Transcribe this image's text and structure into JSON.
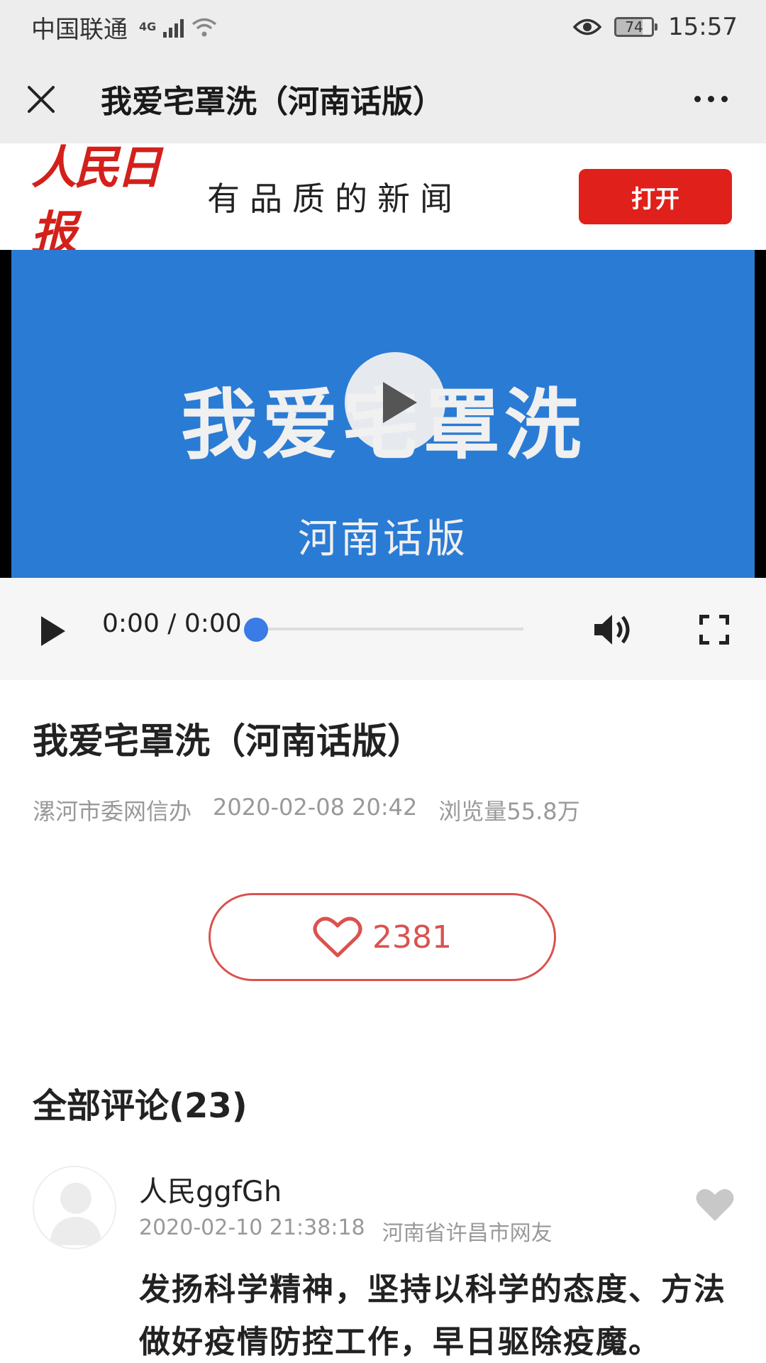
{
  "status_bar": {
    "carrier": "中国联通",
    "network": "4G",
    "battery": "74",
    "time": "15:57"
  },
  "title_bar": {
    "title": "我爱宅罩洗（河南话版）"
  },
  "banner": {
    "logo": "人民日报",
    "slogan": "有品质的新闻",
    "open_label": "打开",
    "brand_color": "#e0201a"
  },
  "video": {
    "title": "我爱宅罩洗",
    "subtitle": "河南话版",
    "background": "#2a7bd4"
  },
  "controls": {
    "time": "0:00 / 0:00",
    "progress": 0
  },
  "article": {
    "title": "我爱宅罩洗（河南话版）",
    "source": "漯河市委网信办",
    "date": "2020-02-08 20:42",
    "views": "浏览量55.8万"
  },
  "like": {
    "count": "2381",
    "color": "#d9534f"
  },
  "comments": {
    "header": "全部评论(23)",
    "items": [
      {
        "user": "人民ggfGh",
        "time": "2020-02-10 21:38:18",
        "location": "河南省许昌市网友",
        "text": "发扬科学精神，坚持以科学的态度、方法做好疫情防控工作，早日驱除疫魔。"
      }
    ]
  },
  "icons": {
    "close": "close-icon",
    "more": "more-icon",
    "play": "play-icon",
    "volume": "volume-icon",
    "fullscreen": "fullscreen-icon",
    "heart": "heart-icon"
  }
}
